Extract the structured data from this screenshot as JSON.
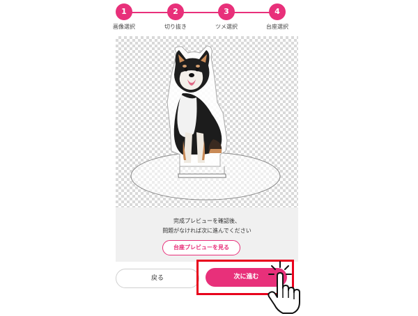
{
  "stepper": {
    "steps": [
      {
        "number": "1",
        "label": "画像選択"
      },
      {
        "number": "2",
        "label": "切り抜き"
      },
      {
        "number": "3",
        "label": "ツメ選択"
      },
      {
        "number": "4",
        "label": "台座選択"
      }
    ]
  },
  "info": {
    "line1": "完成プレビューを確認後、",
    "line2": "問題がなければ次に進んでください",
    "preview_button": "台座プレビューを見る"
  },
  "actions": {
    "back_label": "戻る",
    "next_label": "次に進む"
  },
  "colors": {
    "accent": "#e8307a",
    "highlight": "#e8001c"
  }
}
